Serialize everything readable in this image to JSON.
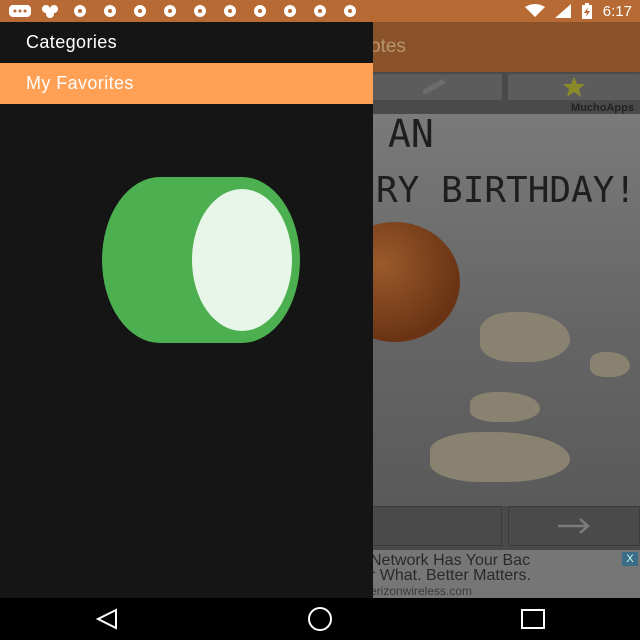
{
  "status_bar": {
    "time": "6:17",
    "icons": [
      "messenger-icon",
      "app-cluster-icon",
      "soccer-ball-icon",
      "soccer-ball-icon",
      "soccer-ball-icon",
      "soccer-ball-icon",
      "soccer-ball-icon",
      "soccer-ball-icon",
      "soccer-ball-icon",
      "soccer-ball-icon",
      "soccer-ball-icon",
      "soccer-ball-icon",
      "wifi-icon",
      "signal-icon",
      "battery-charging-icon"
    ]
  },
  "drawer": {
    "items": [
      {
        "label": "Categories"
      },
      {
        "label": "My Favorites",
        "selected": true
      }
    ],
    "selected_color": "#ffa055",
    "toggle_color": "#4caf50"
  },
  "background_app": {
    "title_fragment": "otes",
    "credit": "MuchoApps",
    "card_line_1": "AN",
    "card_line_2": "RY BIRTHDAY!",
    "ad": {
      "line1": "Network Has Your Bac",
      "line2": "r What. Better Matters.",
      "line3": "erizonwireless.com",
      "close": "X"
    }
  },
  "nav_bar": {
    "buttons": [
      "back-icon",
      "home-icon",
      "recents-icon"
    ]
  }
}
